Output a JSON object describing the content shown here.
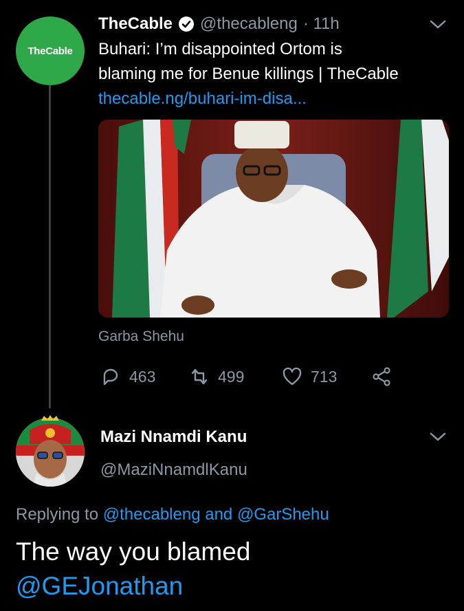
{
  "tweet1": {
    "avatar_text": "TheCable",
    "name": "TheCable",
    "handle": "@thecableng",
    "time": "· 11h",
    "text_line1": "Buhari: I’m disappointed Ortom is",
    "text_line2": "blaming me for Benue killings | TheCable",
    "link": "thecable.ng/buhari-im-disa...",
    "media_caption": "Garba Shehu",
    "reply_count": "463",
    "retweet_count": "499",
    "like_count": "713"
  },
  "tweet2": {
    "name": "Mazi Nnamdi Kanu",
    "handle": "@MaziNnamdlKanu",
    "replying_prefix": "Replying to",
    "reply_handle1": "@thecableng",
    "replying_and": "and",
    "reply_handle2": "@GarShehu",
    "text_line1": "The way you blamed",
    "text_mention": "@GEJonathan"
  },
  "colors": {
    "background": "#000000",
    "secondary_text": "#8b98a5",
    "link": "#1d9bf0",
    "brand_green": "#2fa84a"
  },
  "icons": [
    "verified-badge-icon",
    "chevron-down-icon",
    "reply-icon",
    "retweet-icon",
    "like-icon",
    "share-icon"
  ]
}
